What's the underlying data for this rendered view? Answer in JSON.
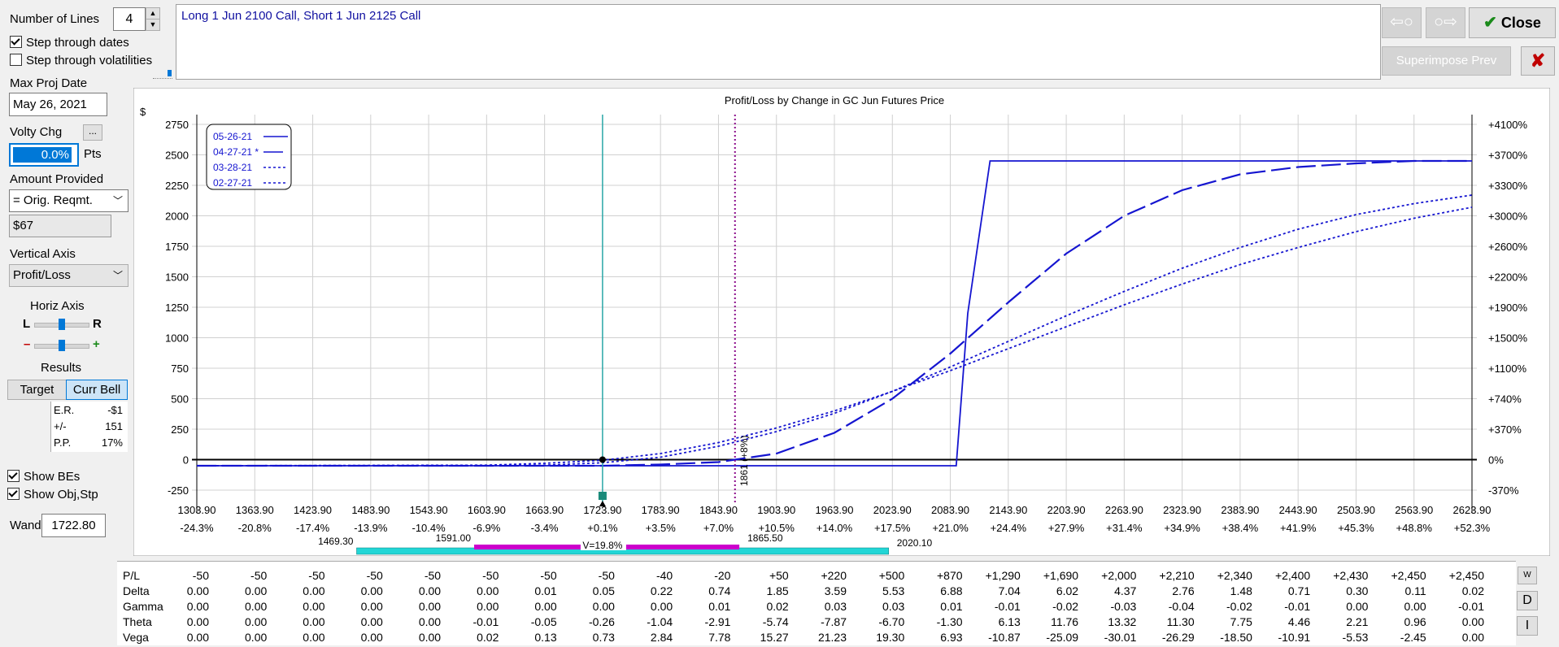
{
  "controls": {
    "num_lines_label": "Number of Lines",
    "num_lines_value": "4",
    "step_dates_label": "Step through dates",
    "step_vols_label": "Step through volatilities",
    "max_proj_date_label": "Max Proj Date",
    "max_proj_date_value": "May 26, 2021",
    "volty_chg_label": "Volty Chg",
    "volty_more": "...",
    "volty_value": "0.0%",
    "volty_units": "Pts",
    "amount_provided_label": "Amount Provided",
    "amount_provided_option": "= Orig. Reqmt.",
    "amount_value": "$67",
    "vertical_axis_label": "Vertical Axis",
    "vertical_axis_option": "Profit/Loss",
    "horiz_axis_label": "Horiz Axis",
    "l_label": "L",
    "r_label": "R",
    "minus_label": "–",
    "plus_label": "+",
    "results_label": "Results",
    "target_tab": "Target",
    "curr_bell_tab": "Curr Bell",
    "results": [
      {
        "k": "E.R.",
        "v": "-$1"
      },
      {
        "k": "+/-",
        "v": "151"
      },
      {
        "k": "P.P.",
        "v": "17%"
      }
    ],
    "show_bes_label": "Show BEs",
    "show_obj_label": "Show Obj,Stp",
    "wand_label": "Wand",
    "wand_value": "1722.80"
  },
  "description": "Long 1 Jun 2100 Call, Short 1 Jun 2125 Call",
  "buttons": {
    "close": "Close",
    "superimpose": "Superimpose Prev"
  },
  "chart_data": {
    "type": "line",
    "title": "Profit/Loss by Change in GC Jun Futures Price",
    "ylabel": "$",
    "xlim": [
      1303.9,
      2623.9
    ],
    "ylim": [
      -250,
      2750
    ],
    "y_ticks": [
      2750,
      2500,
      2250,
      2000,
      1750,
      1500,
      1250,
      1000,
      750,
      500,
      250,
      0,
      -250
    ],
    "y2_ticks": [
      "+4100%",
      "+3700%",
      "+3300%",
      "+3000%",
      "+2600%",
      "+2200%",
      "+1900%",
      "+1500%",
      "+1100%",
      "+740%",
      "+370%",
      "0%",
      "-370%"
    ],
    "x_ticks": [
      1303.9,
      1363.9,
      1423.9,
      1483.9,
      1543.9,
      1603.9,
      1663.9,
      1723.9,
      1783.9,
      1843.9,
      1903.9,
      1963.9,
      2023.9,
      2083.9,
      2143.9,
      2203.9,
      2263.9,
      2323.9,
      2383.9,
      2443.9,
      2503.9,
      2563.9,
      2623.9
    ],
    "x_tick_labels": [
      "1303.90",
      "1363.90",
      "1423.90",
      "1483.90",
      "1543.90",
      "1603.90",
      "1663.90",
      "1723.90",
      "1783.90",
      "1843.90",
      "1903.90",
      "1963.90",
      "2023.90",
      "2083.90",
      "2143.90",
      "2203.90",
      "2263.90",
      "2323.90",
      "2383.90",
      "2443.90",
      "2503.90",
      "2563.90",
      "2623.90"
    ],
    "x_pct_labels": [
      "-24.3%",
      "-20.8%",
      "-17.4%",
      "-13.9%",
      "-10.4%",
      "-6.9%",
      "-3.4%",
      "+0.1%",
      "+3.5%",
      "+7.0%",
      "+10.5%",
      "+14.0%",
      "+17.5%",
      "+21.0%",
      "+24.4%",
      "+27.9%",
      "+31.4%",
      "+34.9%",
      "+38.4%",
      "+41.9%",
      "+45.3%",
      "+48.8%",
      "+52.3%"
    ],
    "legend": [
      "05-26-21",
      "04-27-21 *",
      "03-28-21",
      "02-27-21"
    ],
    "current_price": 1723.9,
    "breakeven_price": 1861,
    "breakeven_label": "1861 (+8%)",
    "bell": {
      "outer_low": "1469.30",
      "inner_low": "1591.00",
      "vol_label": "V=19.8%",
      "inner_high": "1865.50",
      "outer_high": "2020.10"
    },
    "series": [
      {
        "name": "05-26-21",
        "style": "solid",
        "x": [
          1303.9,
          2090,
          2102,
          2125,
          2623.9
        ],
        "y": [
          -50,
          -50,
          1200,
          2450,
          2450
        ]
      },
      {
        "name": "04-27-21 *",
        "style": "longdash",
        "x": [
          1303.9,
          1723.9,
          1783.9,
          1843.9,
          1903.9,
          1963.9,
          2023.9,
          2083.9,
          2143.9,
          2203.9,
          2263.9,
          2323.9,
          2383.9,
          2443.9,
          2503.9,
          2563.9,
          2623.9
        ],
        "y": [
          -50,
          -50,
          -40,
          -20,
          50,
          220,
          500,
          870,
          1290,
          1690,
          2000,
          2210,
          2340,
          2400,
          2430,
          2450,
          2450
        ]
      },
      {
        "name": "03-28-21",
        "style": "dotted",
        "x": [
          1303.9,
          1603.9,
          1663.9,
          1723.9,
          1783.9,
          1843.9,
          1903.9,
          1963.9,
          2023.9,
          2083.9,
          2143.9,
          2203.9,
          2263.9,
          2323.9,
          2383.9,
          2443.9,
          2503.9,
          2563.9,
          2623.9
        ],
        "y": [
          -50,
          -50,
          -45,
          -25,
          20,
          110,
          230,
          380,
          560,
          760,
          970,
          1180,
          1380,
          1570,
          1740,
          1890,
          2010,
          2100,
          2170
        ]
      },
      {
        "name": "02-27-21",
        "style": "dotted",
        "x": [
          1303.9,
          1603.9,
          1663.9,
          1723.9,
          1783.9,
          1843.9,
          1903.9,
          1963.9,
          2023.9,
          2083.9,
          2143.9,
          2203.9,
          2263.9,
          2323.9,
          2383.9,
          2443.9,
          2503.9,
          2563.9,
          2623.9
        ],
        "y": [
          -50,
          -45,
          -30,
          -5,
          50,
          140,
          260,
          400,
          560,
          730,
          910,
          1090,
          1270,
          1440,
          1600,
          1740,
          1870,
          1980,
          2070
        ]
      }
    ]
  },
  "greeks": {
    "labels": [
      "P/L",
      "Delta",
      "Gamma",
      "Theta",
      "Vega"
    ],
    "rows": [
      [
        "-50",
        "-50",
        "-50",
        "-50",
        "-50",
        "-50",
        "-50",
        "-50",
        "-40",
        "-20",
        "+50",
        "+220",
        "+500",
        "+870",
        "+1,290",
        "+1,690",
        "+2,000",
        "+2,210",
        "+2,340",
        "+2,400",
        "+2,430",
        "+2,450",
        "+2,450"
      ],
      [
        "0.00",
        "0.00",
        "0.00",
        "0.00",
        "0.00",
        "0.00",
        "0.01",
        "0.05",
        "0.22",
        "0.74",
        "1.85",
        "3.59",
        "5.53",
        "6.88",
        "7.04",
        "6.02",
        "4.37",
        "2.76",
        "1.48",
        "0.71",
        "0.30",
        "0.11",
        "0.02"
      ],
      [
        "0.00",
        "0.00",
        "0.00",
        "0.00",
        "0.00",
        "0.00",
        "0.00",
        "0.00",
        "0.00",
        "0.01",
        "0.02",
        "0.03",
        "0.03",
        "0.01",
        "-0.01",
        "-0.02",
        "-0.03",
        "-0.04",
        "-0.02",
        "-0.01",
        "0.00",
        "0.00",
        "-0.01"
      ],
      [
        "0.00",
        "0.00",
        "0.00",
        "0.00",
        "0.00",
        "-0.01",
        "-0.05",
        "-0.26",
        "-1.04",
        "-2.91",
        "-5.74",
        "-7.87",
        "-6.70",
        "-1.30",
        "6.13",
        "11.76",
        "13.32",
        "11.30",
        "7.75",
        "4.46",
        "2.21",
        "0.96",
        "0.00"
      ],
      [
        "0.00",
        "0.00",
        "0.00",
        "0.00",
        "0.00",
        "0.02",
        "0.13",
        "0.73",
        "2.84",
        "7.78",
        "15.27",
        "21.23",
        "19.30",
        "6.93",
        "-10.87",
        "-25.09",
        "-30.01",
        "-26.29",
        "-18.50",
        "-10.91",
        "-5.53",
        "-2.45",
        "0.00"
      ]
    ]
  },
  "side_buttons": [
    "W",
    "D",
    "I"
  ],
  "colors": {
    "accent": "#0078d7",
    "series": "#1515d0",
    "teal": "#2aa7a7",
    "magenta": "#cc00cc",
    "cyan": "#22d6d6",
    "close_green": "#1a8a1a",
    "red_x": "#c00000"
  }
}
